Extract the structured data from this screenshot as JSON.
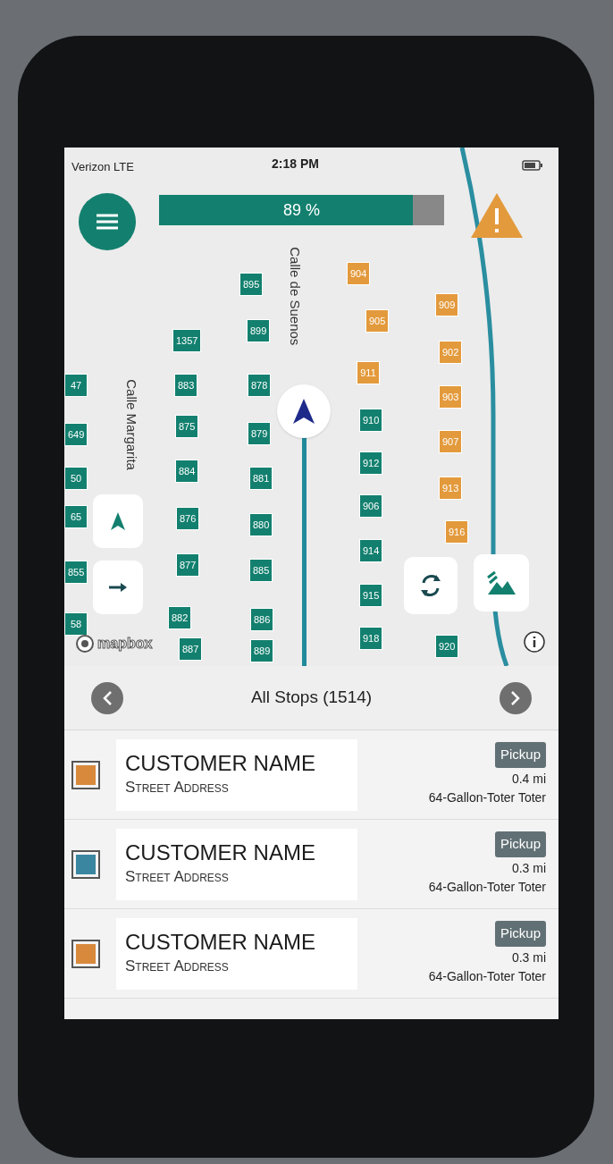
{
  "status_bar": {
    "carrier": "Verizon LTE",
    "time": "2:18 PM"
  },
  "progress": {
    "label": "89 %",
    "level": 0.89
  },
  "map": {
    "streets": [
      "Calle de Suenos",
      "Calle Margarita"
    ],
    "markers": [
      {
        "label": "895",
        "color": "#13806f"
      },
      {
        "label": "1357",
        "color": "#13806f"
      },
      {
        "label": "899",
        "color": "#13806f"
      },
      {
        "label": "883",
        "color": "#13806f"
      },
      {
        "label": "878",
        "color": "#13806f"
      },
      {
        "label": "875",
        "color": "#13806f"
      },
      {
        "label": "879",
        "color": "#13806f"
      },
      {
        "label": "884",
        "color": "#13806f"
      },
      {
        "label": "881",
        "color": "#13806f"
      },
      {
        "label": "876",
        "color": "#13806f"
      },
      {
        "label": "880",
        "color": "#13806f"
      },
      {
        "label": "877",
        "color": "#13806f"
      },
      {
        "label": "885",
        "color": "#13806f"
      },
      {
        "label": "882",
        "color": "#13806f"
      },
      {
        "label": "886",
        "color": "#13806f"
      },
      {
        "label": "887",
        "color": "#13806f"
      },
      {
        "label": "889",
        "color": "#13806f"
      },
      {
        "label": "910",
        "color": "#13806f"
      },
      {
        "label": "912",
        "color": "#13806f"
      },
      {
        "label": "906",
        "color": "#13806f"
      },
      {
        "label": "914",
        "color": "#13806f"
      },
      {
        "label": "915",
        "color": "#13806f"
      },
      {
        "label": "918",
        "color": "#13806f"
      },
      {
        "label": "920",
        "color": "#13806f"
      },
      {
        "label": "904",
        "color": "#e39a3c"
      },
      {
        "label": "909",
        "color": "#e39a3c"
      },
      {
        "label": "905",
        "color": "#e39a3c"
      },
      {
        "label": "902",
        "color": "#e39a3c"
      },
      {
        "label": "911",
        "color": "#e39a3c"
      },
      {
        "label": "903",
        "color": "#e39a3c"
      },
      {
        "label": "907",
        "color": "#e39a3c"
      },
      {
        "label": "913",
        "color": "#e39a3c"
      },
      {
        "label": "916",
        "color": "#e39a3c"
      },
      {
        "label": "47",
        "color": "#13806f"
      },
      {
        "label": "649",
        "color": "#13806f"
      },
      {
        "label": "50",
        "color": "#13806f"
      },
      {
        "label": "65",
        "color": "#13806f"
      },
      {
        "label": "855",
        "color": "#13806f"
      },
      {
        "label": "58",
        "color": "#13806f"
      }
    ],
    "attribution": "mapbox"
  },
  "stops_header": {
    "title": "All Stops (1514)"
  },
  "stops": [
    {
      "name": "CUSTOMER NAME",
      "address": "Street Address",
      "color": "#d8893c",
      "type": "Pickup",
      "distance": "0.4 mi",
      "container": "64-Gallon-Toter Toter"
    },
    {
      "name": "CUSTOMER NAME",
      "address": "Street Address",
      "color": "#3a86a0",
      "type": "Pickup",
      "distance": "0.3 mi",
      "container": "64-Gallon-Toter Toter"
    },
    {
      "name": "CUSTOMER NAME",
      "address": "Street Address",
      "color": "#d8893c",
      "type": "Pickup",
      "distance": "0.3 mi",
      "container": "64-Gallon-Toter Toter"
    }
  ]
}
